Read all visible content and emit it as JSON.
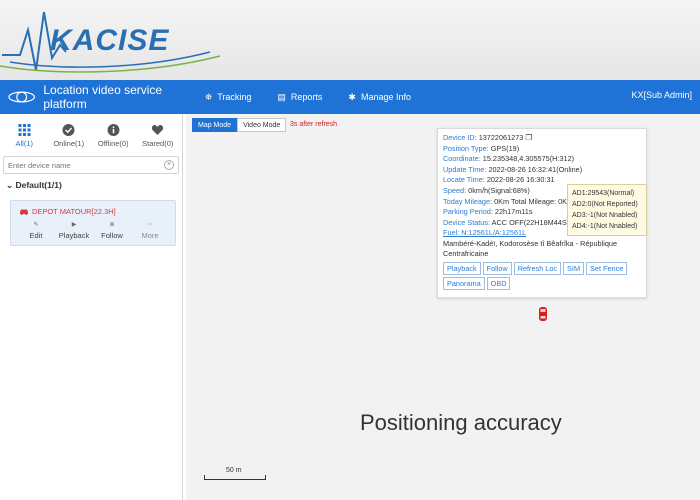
{
  "brand": {
    "logo_text": "KACISE"
  },
  "navbar": {
    "title": "Location video service platform",
    "items": [
      {
        "label": "Tracking",
        "icon": "tracking-icon"
      },
      {
        "label": "Reports",
        "icon": "reports-icon"
      },
      {
        "label": "Manage Info",
        "icon": "gear-icon"
      }
    ],
    "user": "KX[Sub Admin]"
  },
  "sidebar": {
    "filters": [
      {
        "label": "All(1)",
        "icon": "grid-icon"
      },
      {
        "label": "Online(1)",
        "icon": "check-circle-icon"
      },
      {
        "label": "Offline(0)",
        "icon": "info-circle-icon"
      },
      {
        "label": "Stared(0)",
        "icon": "heart-icon"
      }
    ],
    "search_placeholder": "Enter device name",
    "group": "Default(1/1)",
    "device": {
      "name": "DEPOT MATOUR[22.3H]",
      "actions": [
        "Edit",
        "Playback",
        "Follow",
        "More"
      ]
    }
  },
  "map": {
    "modes": [
      "Map Mode",
      "Video Mode"
    ],
    "refresh_text": "3s after refresh",
    "popup": {
      "device_id_label": "Device ID:",
      "device_id": "13722061273",
      "position_type_label": "Position Type:",
      "position_type": "GPS(19)",
      "coordinate_label": "Coordinate:",
      "coordinate": "15.235348,4.305575(H:312)",
      "update_time_label": "Update Time:",
      "update_time": "2022-08-26 16:32:41(Online)",
      "locate_time_label": "Locate Time:",
      "locate_time": "2022-08-26 16:30:31",
      "speed_label": "Speed:",
      "speed": "0km/h(Signal:68%)",
      "mileage_label": "Today Mileage:",
      "mileage": "0Km Total Mileage: 0Km",
      "parking_label": "Parking Period:",
      "parking": "22h17m11s",
      "status_label": "Device Status:",
      "status": "ACC OFF(22H18M44S)",
      "fuel": "Fuel: N:12561L/A:12561L",
      "address": "Mambéré-Kadéï, Kodorosèse tî Bêafrîka - République Centrafricaine",
      "buttons": [
        "Playback",
        "Follow",
        "Refresh Loc",
        "SIM",
        "Set Fence",
        "Panorama",
        "OBD"
      ]
    },
    "ad_tooltip": [
      "AD1:29543(Normal)",
      "AD2:0(Not Reported)",
      "AD3:-1(Not Nnabled)",
      "AD4:-1(Not Nnabled)"
    ],
    "caption": "Positioning accuracy",
    "scale_label": "50 m"
  }
}
